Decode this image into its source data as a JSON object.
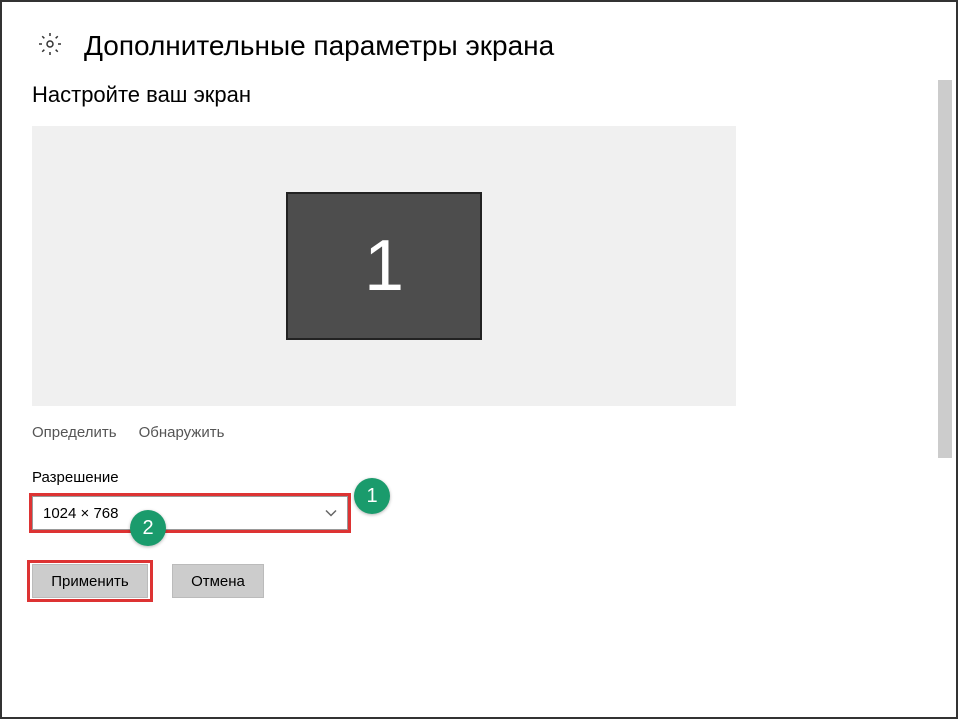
{
  "header": {
    "title": "Дополнительные параметры экрана"
  },
  "section": {
    "title": "Настройте ваш экран"
  },
  "monitor": {
    "number": "1"
  },
  "links": {
    "identify": "Определить",
    "detect": "Обнаружить"
  },
  "resolution": {
    "label": "Разрешение",
    "value": "1024 × 768"
  },
  "buttons": {
    "apply": "Применить",
    "cancel": "Отмена"
  },
  "annotations": {
    "badge1": "1",
    "badge2": "2"
  }
}
